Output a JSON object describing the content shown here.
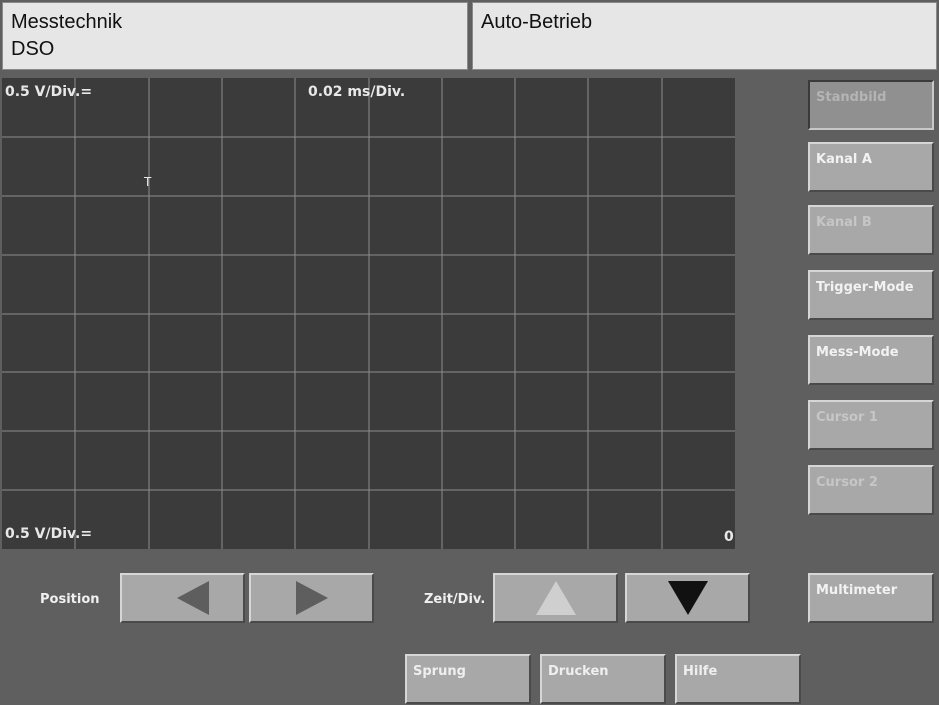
{
  "header": {
    "section": "Messtechnik",
    "mode": "DSO",
    "status": "Auto-Betrieb"
  },
  "scope": {
    "channel_a_scale": "0.5 V/Div.=",
    "timebase": "0.02 ms/Div.",
    "channel_b_scale": "0.5 V/Div.=",
    "zero_marker": "0",
    "trigger_marker": "T"
  },
  "side_buttons": {
    "standbild": "Standbild",
    "kanal_a": "Kanal A",
    "kanal_b": "Kanal B",
    "trigger_mode": "Trigger-Mode",
    "mess_mode": "Mess-Mode",
    "cursor1": "Cursor 1",
    "cursor2": "Cursor 2",
    "multimeter": "Multimeter"
  },
  "controls": {
    "position_label": "Position",
    "zeit_div_label": "Zeit/Div."
  },
  "bottom_buttons": {
    "sprung": "Sprung",
    "drucken": "Drucken",
    "hilfe": "Hilfe"
  },
  "colors": {
    "screen_bg": "#3b3b3b",
    "grid": "#8c8c8c",
    "trace": "#e4e4e4"
  },
  "icons": {
    "position_left": "arrow-left-icon",
    "position_right": "arrow-right-icon",
    "zeit_up": "arrow-up-icon",
    "zeit_down": "arrow-down-icon"
  }
}
